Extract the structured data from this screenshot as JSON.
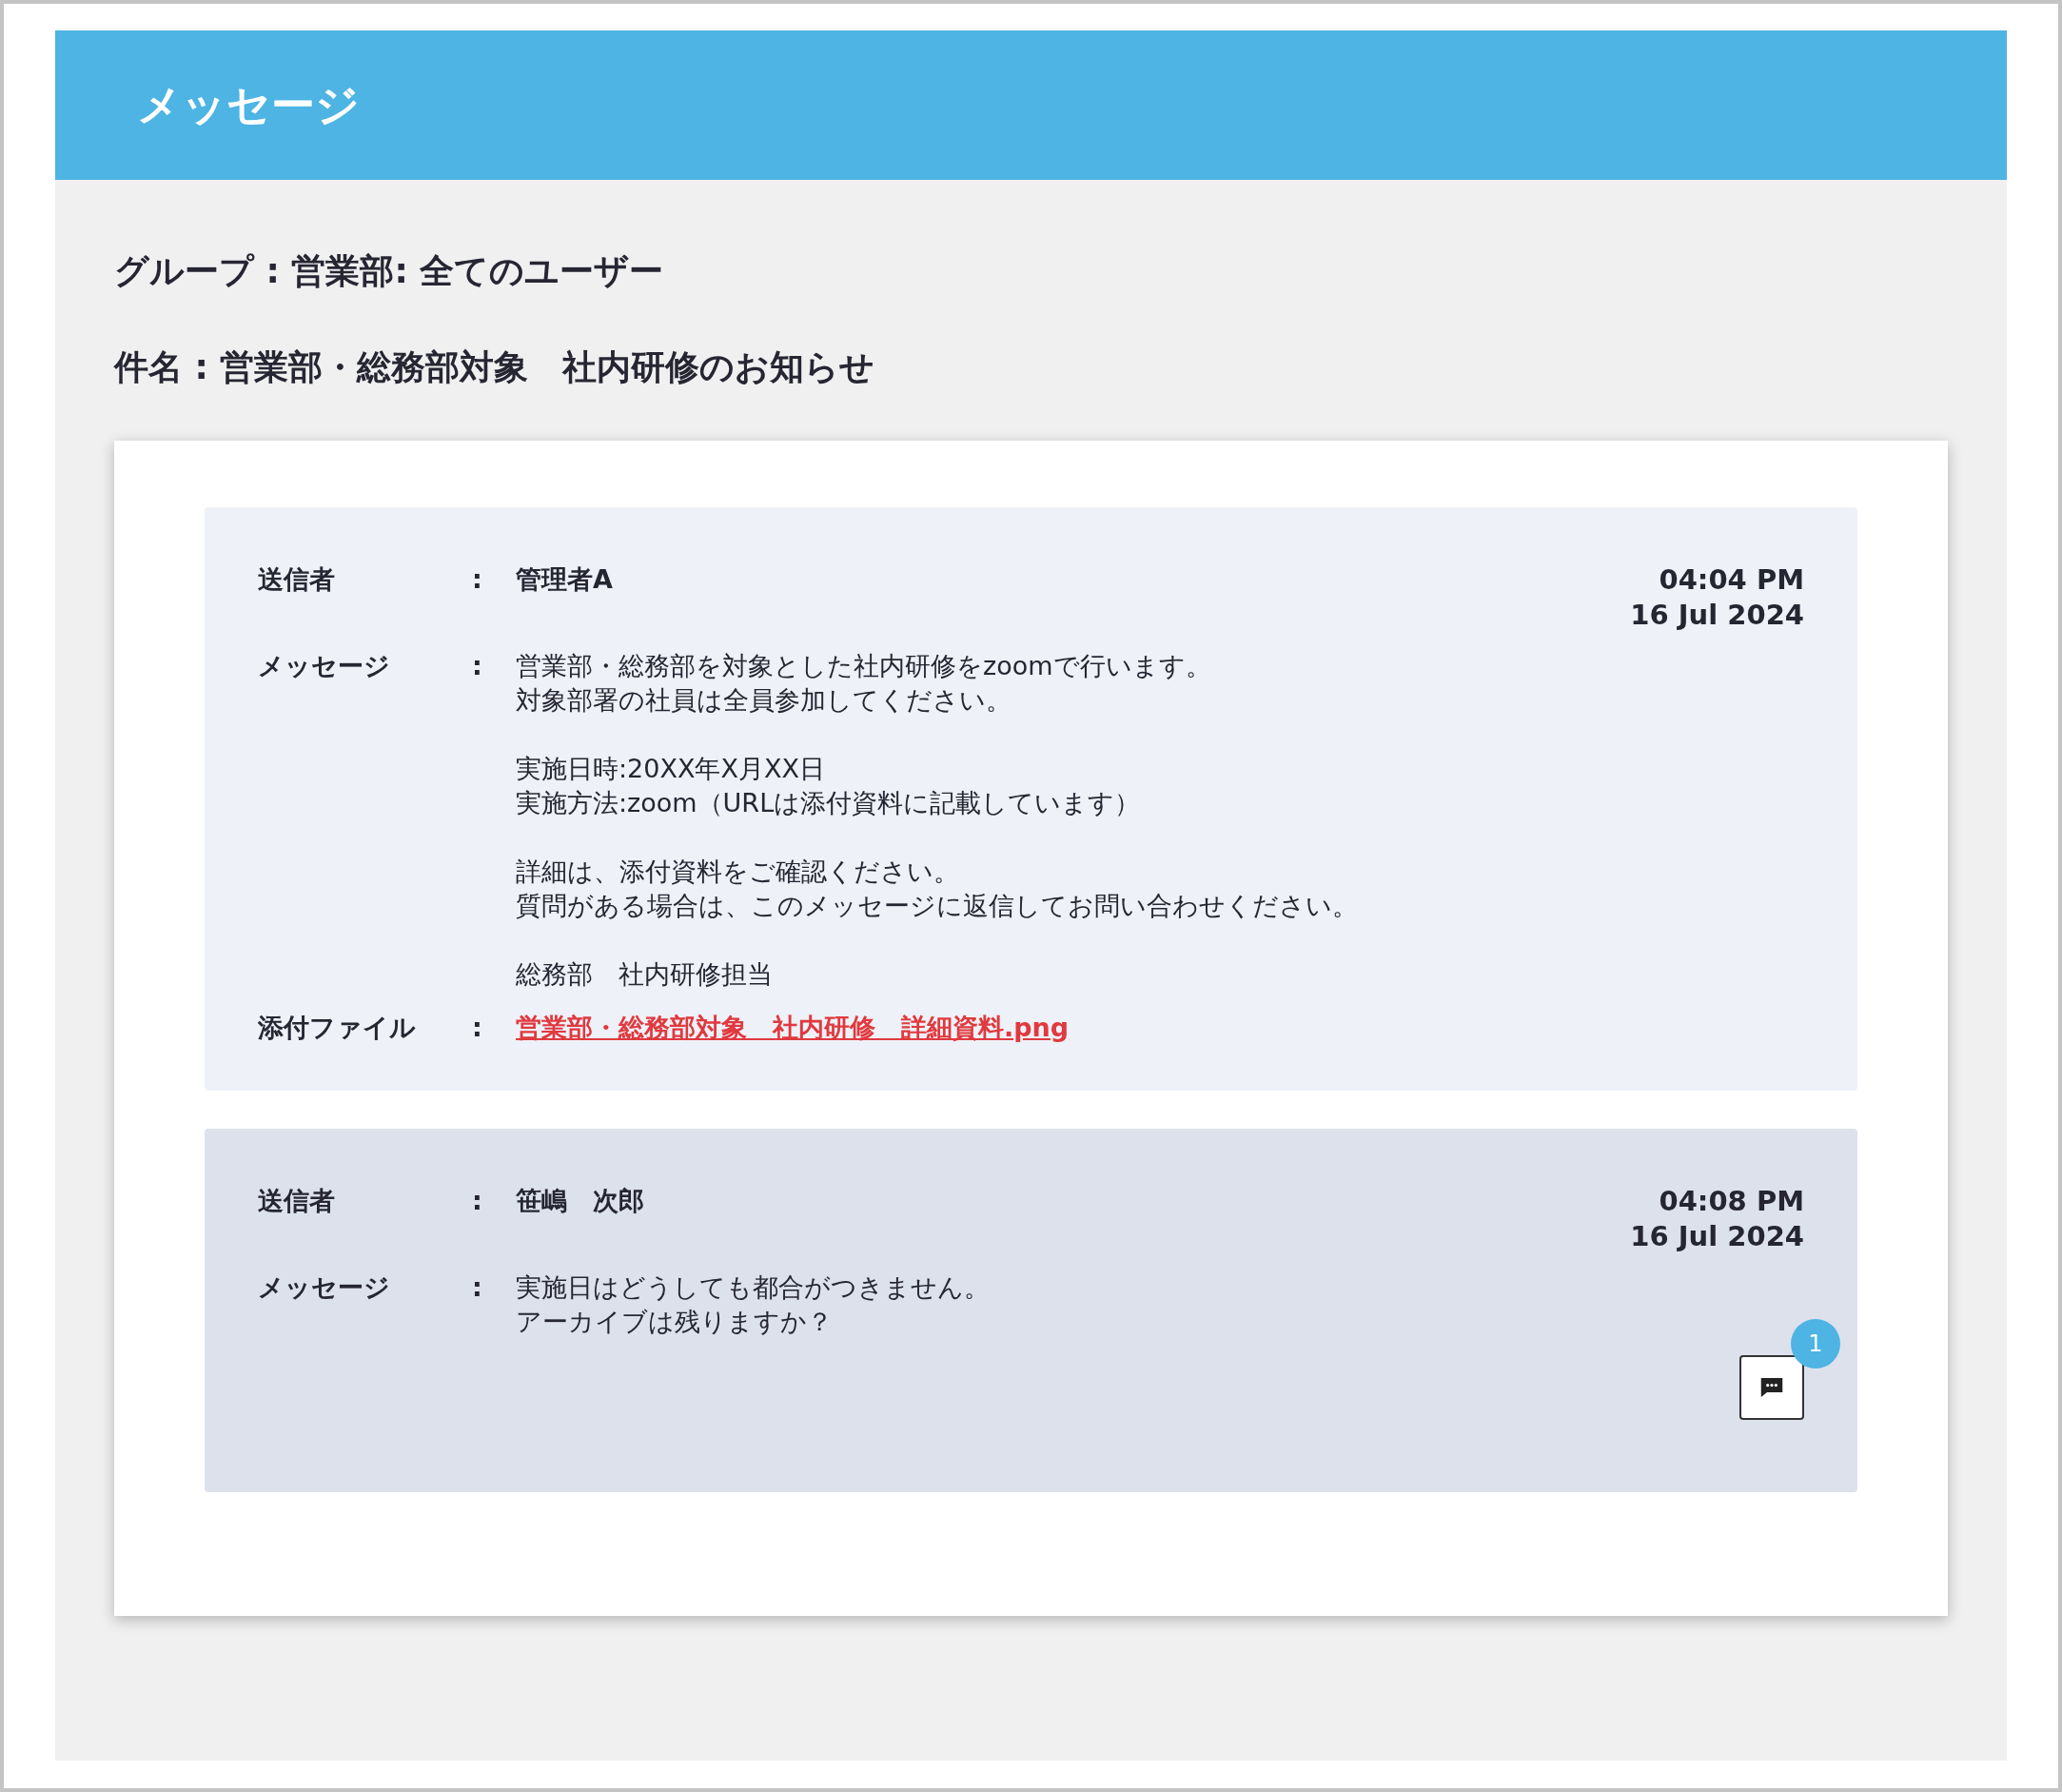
{
  "header": {
    "title": "メッセージ"
  },
  "group": "グループ : 営業部: 全てのユーザー",
  "subject": "件名 : 営業部・総務部対象　社内研修のお知らせ",
  "messages": [
    {
      "kind": "original",
      "sender_label": "送信者",
      "sender_colon": ":",
      "sender": "管理者A",
      "time": "04:04 PM",
      "date": "16 Jul 2024",
      "message_label": "メッセージ",
      "message_colon": ":",
      "paragraphs": [
        [
          "営業部・総務部を対象とした社内研修をzoomで行います。",
          "対象部署の社員は全員参加してください。"
        ],
        [
          "実施日時:20XX年X月XX日",
          "実施方法:zoom（URLは添付資料に記載しています）"
        ],
        [
          "詳細は、添付資料をご確認ください。",
          "質問がある場合は、このメッセージに返信してお問い合わせください。"
        ],
        [
          "総務部　社内研修担当"
        ]
      ],
      "attachment_label": "添付ファイル",
      "attachment_colon": ":",
      "attachment": "営業部・総務部対象　社内研修　詳細資料.png"
    },
    {
      "kind": "reply",
      "sender_label": "送信者",
      "sender_colon": ":",
      "sender": "笹嶋　次郎",
      "time": "04:08 PM",
      "date": "16 Jul 2024",
      "message_label": "メッセージ",
      "message_colon": ":",
      "paragraphs": [
        [
          "実施日はどうしても都合がつきません。",
          "アーカイブは残りますか？"
        ]
      ],
      "reply_badge": "1"
    }
  ]
}
